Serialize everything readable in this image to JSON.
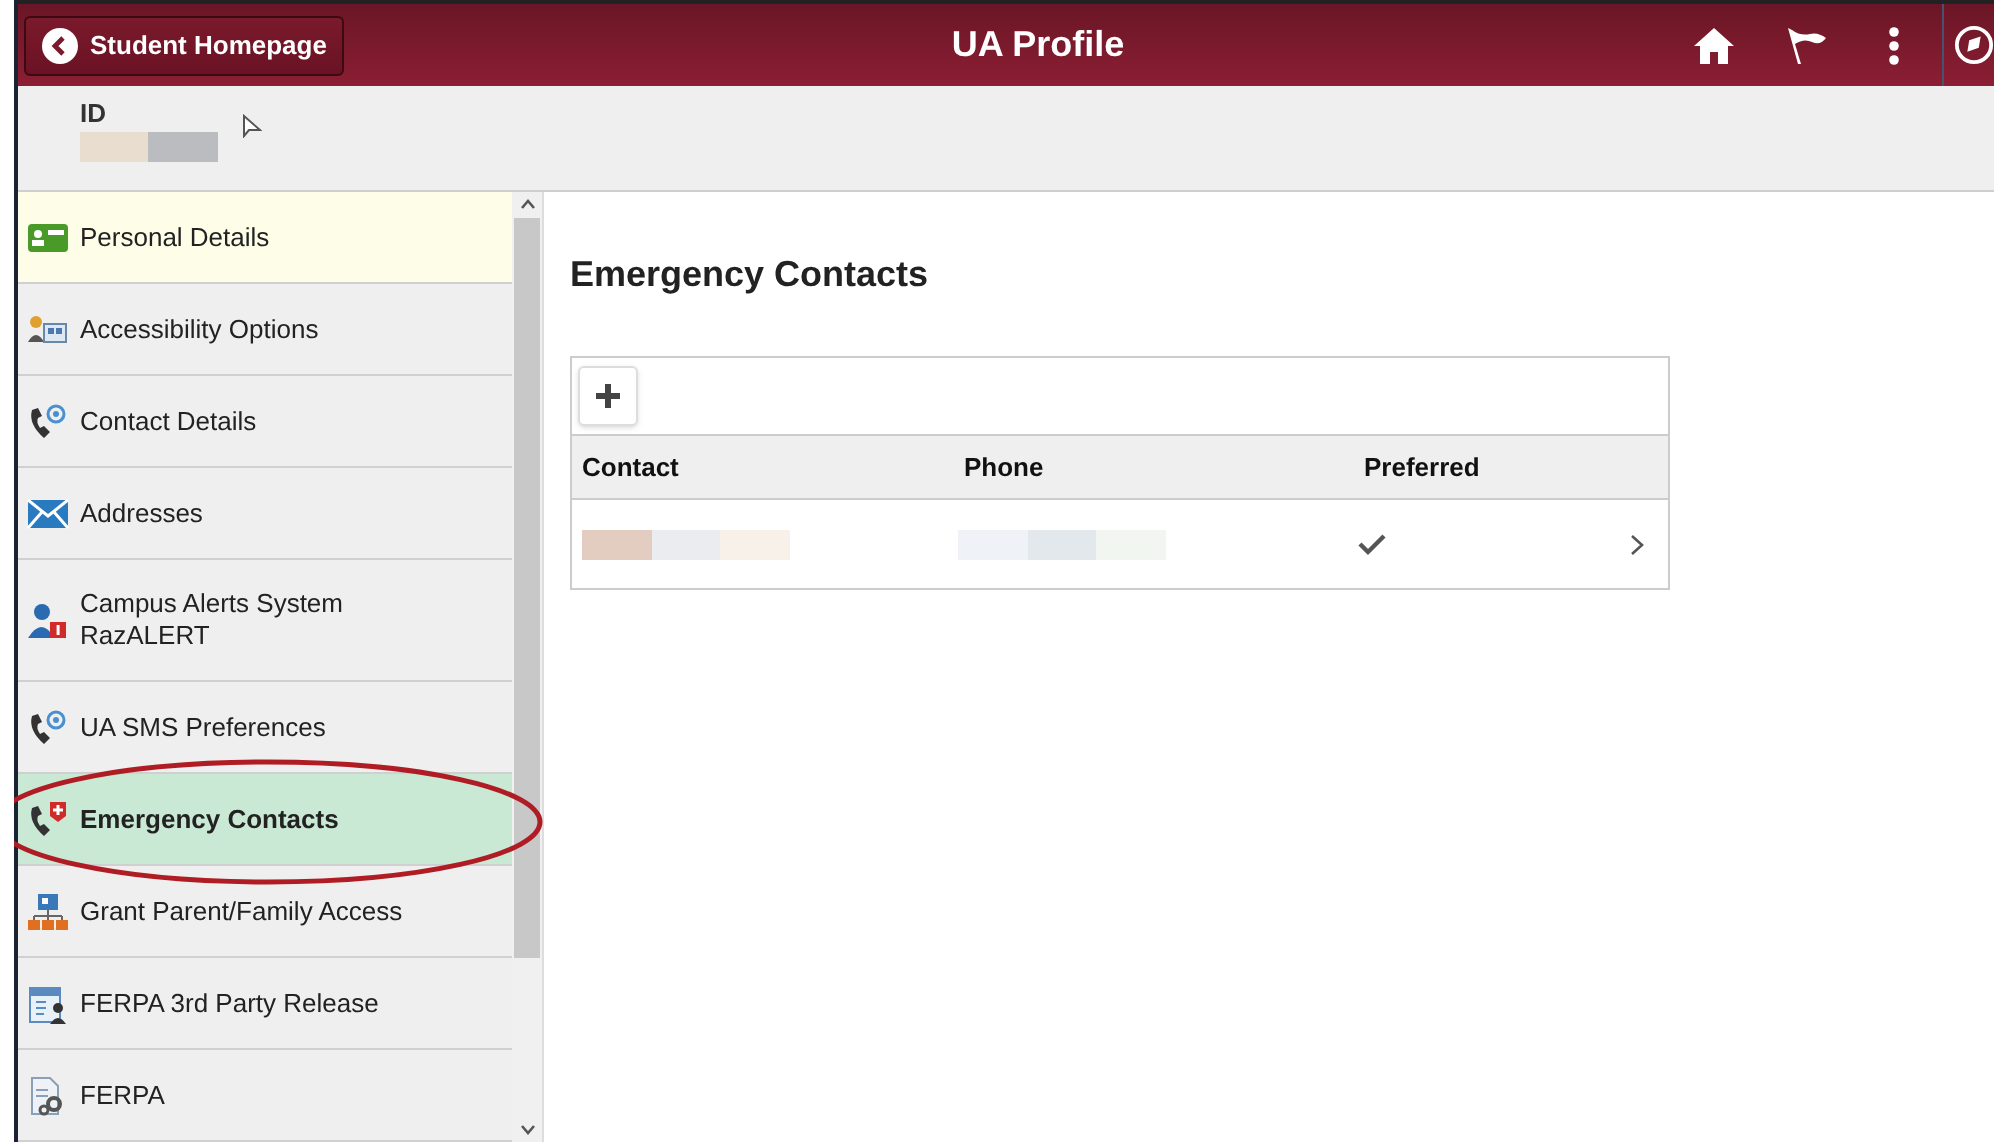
{
  "header": {
    "back_button": "Student Homepage",
    "title": "UA Profile"
  },
  "student": {
    "id_label": "ID"
  },
  "sidebar": {
    "items": [
      {
        "label": "Personal Details",
        "selected": false,
        "hovered": true
      },
      {
        "label": "Accessibility Options",
        "selected": false,
        "hovered": false
      },
      {
        "label": "Contact Details",
        "selected": false,
        "hovered": false
      },
      {
        "label": "Addresses",
        "selected": false,
        "hovered": false
      },
      {
        "label": "Campus Alerts System RazALERT",
        "selected": false,
        "hovered": false
      },
      {
        "label": "UA SMS Preferences",
        "selected": false,
        "hovered": false
      },
      {
        "label": "Emergency Contacts",
        "selected": true,
        "hovered": false
      },
      {
        "label": "Grant Parent/Family Access",
        "selected": false,
        "hovered": false
      },
      {
        "label": "FERPA 3rd Party Release",
        "selected": false,
        "hovered": false
      },
      {
        "label": "FERPA",
        "selected": false,
        "hovered": false
      }
    ]
  },
  "content": {
    "title": "Emergency Contacts",
    "table": {
      "columns": [
        "Contact",
        "Phone",
        "Preferred"
      ],
      "rows": [
        {
          "preferred": true
        }
      ]
    }
  }
}
